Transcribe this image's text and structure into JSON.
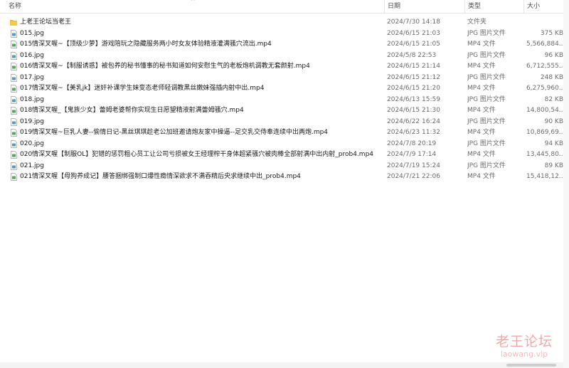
{
  "columns": {
    "name": "名称",
    "date": "日期",
    "type": "类型",
    "size": "大小",
    "sort_indicator": "^"
  },
  "colors": {
    "folder": "#e8b84a",
    "jpg_icon": "#4a9cd8",
    "mp4_icon": "#4caf50"
  },
  "rows": [
    {
      "icon": "folder-icon",
      "name": "上老王论坛当老王",
      "date": "2024/7/30 14:18",
      "type": "文件夹",
      "size": ""
    },
    {
      "icon": "jpg-file-icon",
      "name": "015.jpg",
      "date": "2024/6/15 21:03",
      "type": "JPG 图片文件",
      "size": "375 KB"
    },
    {
      "icon": "mp4-file-icon",
      "name": "015情深叉喔~【顶级少萝】游戏陪玩之隐藏服务两小时女友体验精液灌满骚穴流出.mp4",
      "date": "2024/6/15 21:05",
      "type": "MP4 文件",
      "size": "5,566,884..."
    },
    {
      "icon": "jpg-file-icon",
      "name": "016.jpg",
      "date": "2024/5/8 22:53",
      "type": "JPG 图片文件",
      "size": "96 KB"
    },
    {
      "icon": "mp4-file-icon",
      "name": "016情深叉喔~【制服诱惑】被包养的秘书懂事的秘书知道如何安慰生气的老板炮机调教无套颜射.mp4",
      "date": "2024/6/15 21:14",
      "type": "MP4 文件",
      "size": "6,712,555..."
    },
    {
      "icon": "jpg-file-icon",
      "name": "017.jpg",
      "date": "2024/6/15 21:12",
      "type": "JPG 图片文件",
      "size": "248 KB"
    },
    {
      "icon": "mp4-file-icon",
      "name": "017情深叉喔~【美乳jk】迷奸补课学生妹变态老师轻调教黑丝嫩妹强插内射中出.mp4",
      "date": "2024/6/15 21:20",
      "type": "MP4 文件",
      "size": "6,275,960..."
    },
    {
      "icon": "jpg-file-icon",
      "name": "018.jpg",
      "date": "2024/6/13 15:59",
      "type": "JPG 图片文件",
      "size": "82 KB"
    },
    {
      "icon": "mp4-file-icon",
      "name": "018情深叉喔_【鬼族少女】蕾姆老婆帮你实现生日愿望精液射满蕾姆骚穴.mp4",
      "date": "2024/6/15 21:30",
      "type": "MP4 文件",
      "size": "14,800,54..."
    },
    {
      "icon": "jpg-file-icon",
      "name": "019.jpg",
      "date": "2024/6/22 16:24",
      "type": "JPG 图片文件",
      "size": "90 KB"
    },
    {
      "icon": "mp4-file-icon",
      "name": "019情深叉喔~巨乳人妻--偷情日记-黑丝琪琪趁老公加班邀请炮友家中操逼--足交乳交侍奉连续中出两炮.mp4",
      "date": "2024/6/23 11:32",
      "type": "MP4 文件",
      "size": "10,869,69..."
    },
    {
      "icon": "jpg-file-icon",
      "name": "020.jpg",
      "date": "2024/7/8 20:19",
      "type": "JPG 图片文件",
      "size": "94 KB"
    },
    {
      "icon": "mp4-file-icon",
      "name": "020情深叉喔【制服OL】犯错的惩罚粗心员工让公司亏损被女王经理榨干身体超紧骚穴被肉棒全部射满中出内射_prob4.mp4",
      "date": "2024/7/9 17:14",
      "type": "MP4 文件",
      "size": "13,445,80..."
    },
    {
      "icon": "jpg-file-icon",
      "name": "021.jpg",
      "date": "2024/7/19 15:24",
      "type": "JPG 图片文件",
      "size": "89 KB"
    },
    {
      "icon": "mp4-file-icon",
      "name": "021情深叉喔【母狗养成记】腰答捆绑强制口爆性瘾情深欲求不满吞精后央求继续中出_prob4.mp4",
      "date": "2024/7/21 22:06",
      "type": "MP4 文件",
      "size": "15,418,12..."
    }
  ],
  "watermark": {
    "text": "老王论坛",
    "url": "laowang.vip"
  }
}
